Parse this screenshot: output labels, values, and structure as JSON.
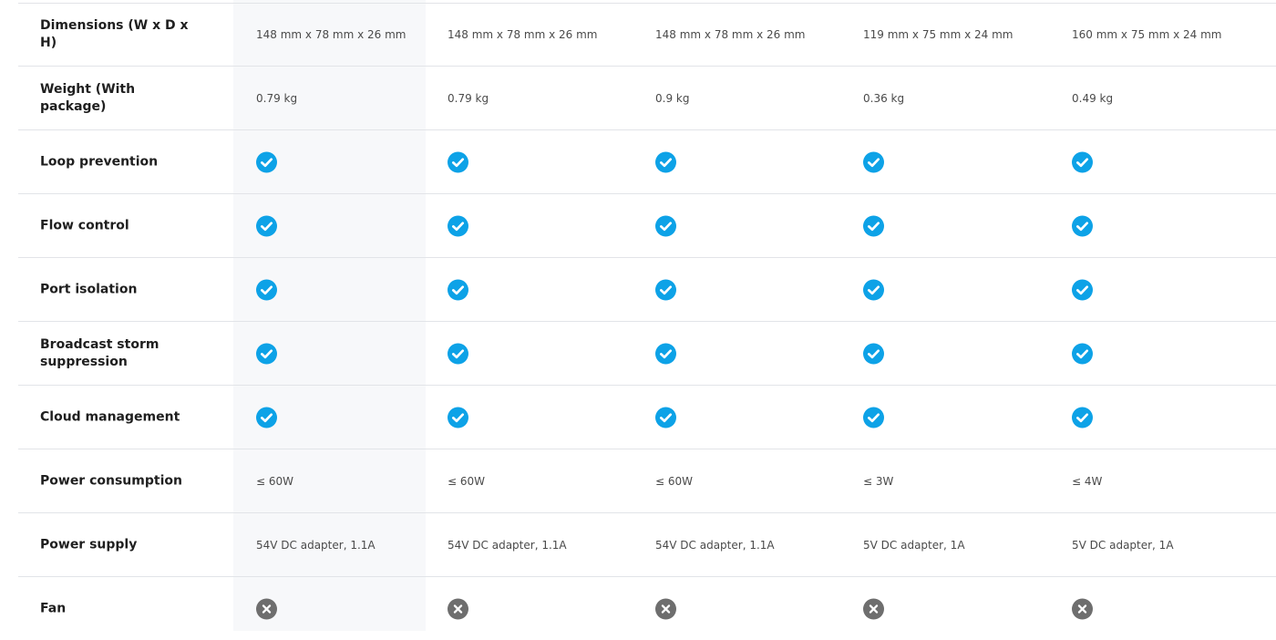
{
  "colors": {
    "check": "#0da2e7",
    "cross": "#6e6e6e",
    "highlight_column": "#f7f8fa",
    "divider": "#e2e4e8"
  },
  "rows": [
    {
      "label": "Dimensions (W x D x H)",
      "type": "text",
      "values": [
        "148 mm x 78 mm x 26 mm",
        "148 mm x 78 mm x 26 mm",
        "148 mm x 78 mm x 26 mm",
        "119 mm x 75 mm x 24 mm",
        "160 mm x 75 mm x 24 mm"
      ]
    },
    {
      "label": "Weight (With package)",
      "type": "text",
      "values": [
        "0.79 kg",
        "0.79 kg",
        "0.9 kg",
        "0.36 kg",
        "0.49 kg"
      ]
    },
    {
      "label": "Loop prevention",
      "type": "icon",
      "values": [
        "check-circle-icon",
        "check-circle-icon",
        "check-circle-icon",
        "check-circle-icon",
        "check-circle-icon"
      ]
    },
    {
      "label": "Flow control",
      "type": "icon",
      "values": [
        "check-circle-icon",
        "check-circle-icon",
        "check-circle-icon",
        "check-circle-icon",
        "check-circle-icon"
      ]
    },
    {
      "label": "Port isolation",
      "type": "icon",
      "values": [
        "check-circle-icon",
        "check-circle-icon",
        "check-circle-icon",
        "check-circle-icon",
        "check-circle-icon"
      ]
    },
    {
      "label": "Broadcast storm suppression",
      "type": "icon",
      "values": [
        "check-circle-icon",
        "check-circle-icon",
        "check-circle-icon",
        "check-circle-icon",
        "check-circle-icon"
      ]
    },
    {
      "label": "Cloud management",
      "type": "icon",
      "values": [
        "check-circle-icon",
        "check-circle-icon",
        "check-circle-icon",
        "check-circle-icon",
        "check-circle-icon"
      ]
    },
    {
      "label": "Power consumption",
      "type": "text",
      "values": [
        "≤ 60W",
        "≤ 60W",
        "≤ 60W",
        "≤ 3W",
        "≤ 4W"
      ]
    },
    {
      "label": "Power supply",
      "type": "text",
      "values": [
        "54V DC adapter, 1.1A",
        "54V DC adapter, 1.1A",
        "54V DC adapter, 1.1A",
        "5V DC adapter, 1A",
        "5V DC adapter, 1A"
      ]
    },
    {
      "label": "Fan",
      "type": "icon",
      "values": [
        "cross-circle-icon",
        "cross-circle-icon",
        "cross-circle-icon",
        "cross-circle-icon",
        "cross-circle-icon"
      ]
    }
  ]
}
